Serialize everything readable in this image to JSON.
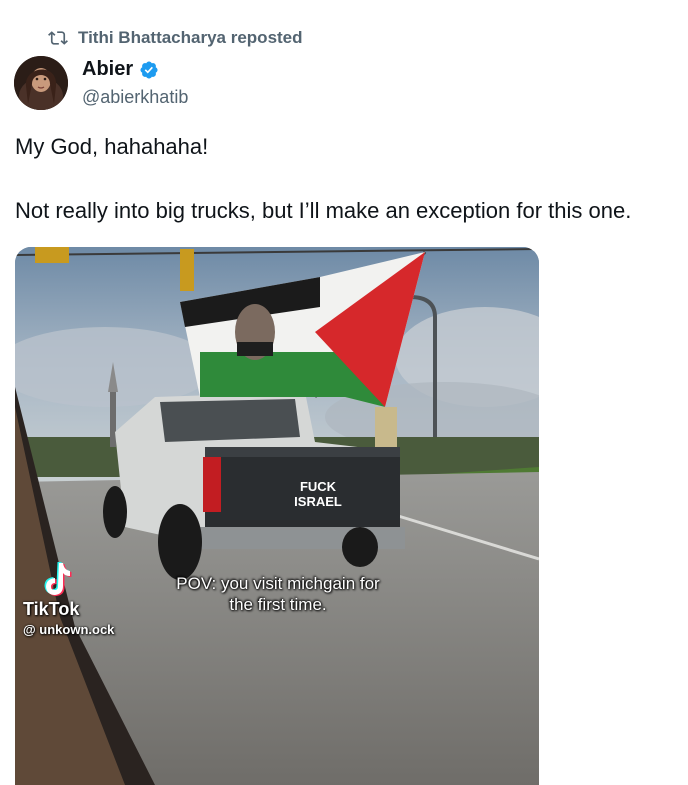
{
  "repost": {
    "label": "Tithi Bhattacharya reposted",
    "icon": "repost-icon"
  },
  "author": {
    "display_name": "Abier",
    "handle": "@abierkhatib",
    "verified": true,
    "verified_color": "#1d9bf0"
  },
  "tweet": {
    "line1": "My God, hahahaha!",
    "line2": "Not really into big trucks, but I’ll make an exception for this one."
  },
  "media": {
    "caption_line1": "POV: you visit michgain for",
    "caption_line2": "the first time.",
    "tiktok_brand": "TikTok",
    "tiktok_handle": "@ unkown.ock",
    "truck_text_line1": "FUCK",
    "truck_text_line2": "ISRAEL"
  },
  "colors": {
    "text_primary": "#0f1419",
    "text_secondary": "#536471",
    "flag_red": "#d6282b",
    "flag_green": "#2f8a3a"
  }
}
